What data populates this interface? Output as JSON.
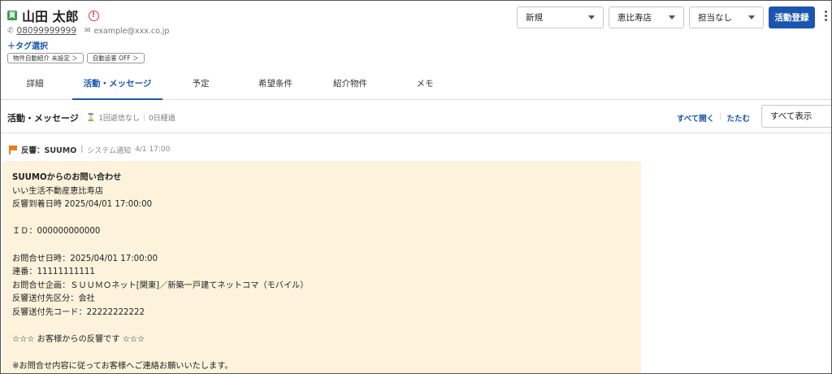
{
  "customer": {
    "badge_glyph": "買",
    "name": "山田 太郎",
    "phone": "08099999999",
    "email": "example@xxx.co.jp",
    "tag_link": "＋タグ選択",
    "chips": [
      "物件自動紹介 未設定 ＞",
      "自動追客 OFF ＞"
    ]
  },
  "controls": {
    "status_select": "新規",
    "store_select": "恵比寿店",
    "assignee_select": "担当なし",
    "register_button": "活動登録"
  },
  "tabs": [
    {
      "label": "詳細"
    },
    {
      "label": "活動・メッセージ"
    },
    {
      "label": "予定"
    },
    {
      "label": "希望条件"
    },
    {
      "label": "紹介物件"
    },
    {
      "label": "メモ"
    }
  ],
  "active_tab": "活動・メッセージ",
  "section": {
    "title": "活動・メッセージ",
    "no_reply": "1回返信なし",
    "elapsed": "0日経過",
    "expand_all": "すべて開く",
    "collapse": "たたむ",
    "filter_select": "すべて表示"
  },
  "activity": {
    "kind": "反響：SUUMO",
    "source": "システム通知",
    "time": "4/1 17:00",
    "message_lines": [
      "SUUMOからのお問い合わせ",
      "いい生活不動産恵比寿店",
      "反響到着日時 2025/04/01 17:00:00",
      "",
      "ＩＤ：000000000000",
      "",
      "お問合せ日時：2025/04/01 17:00:00",
      "連番：11111111111",
      "お問合せ企画：ＳＵＵＭＯネット[関東]／新築一戸建てネットコマ（モバイル）",
      "反響送付先区分：会社",
      "反響送付先コード：22222222222",
      "",
      "☆☆☆ お客様からの反響です ☆☆☆",
      "",
      "※お問合せ内容に従ってお客様へご連絡お願いいたします。"
    ]
  },
  "colors": {
    "accent": "#1a56b0",
    "message_bg": "#fdf3dc",
    "flag": "#e87f1a",
    "alert": "#d9363e"
  }
}
